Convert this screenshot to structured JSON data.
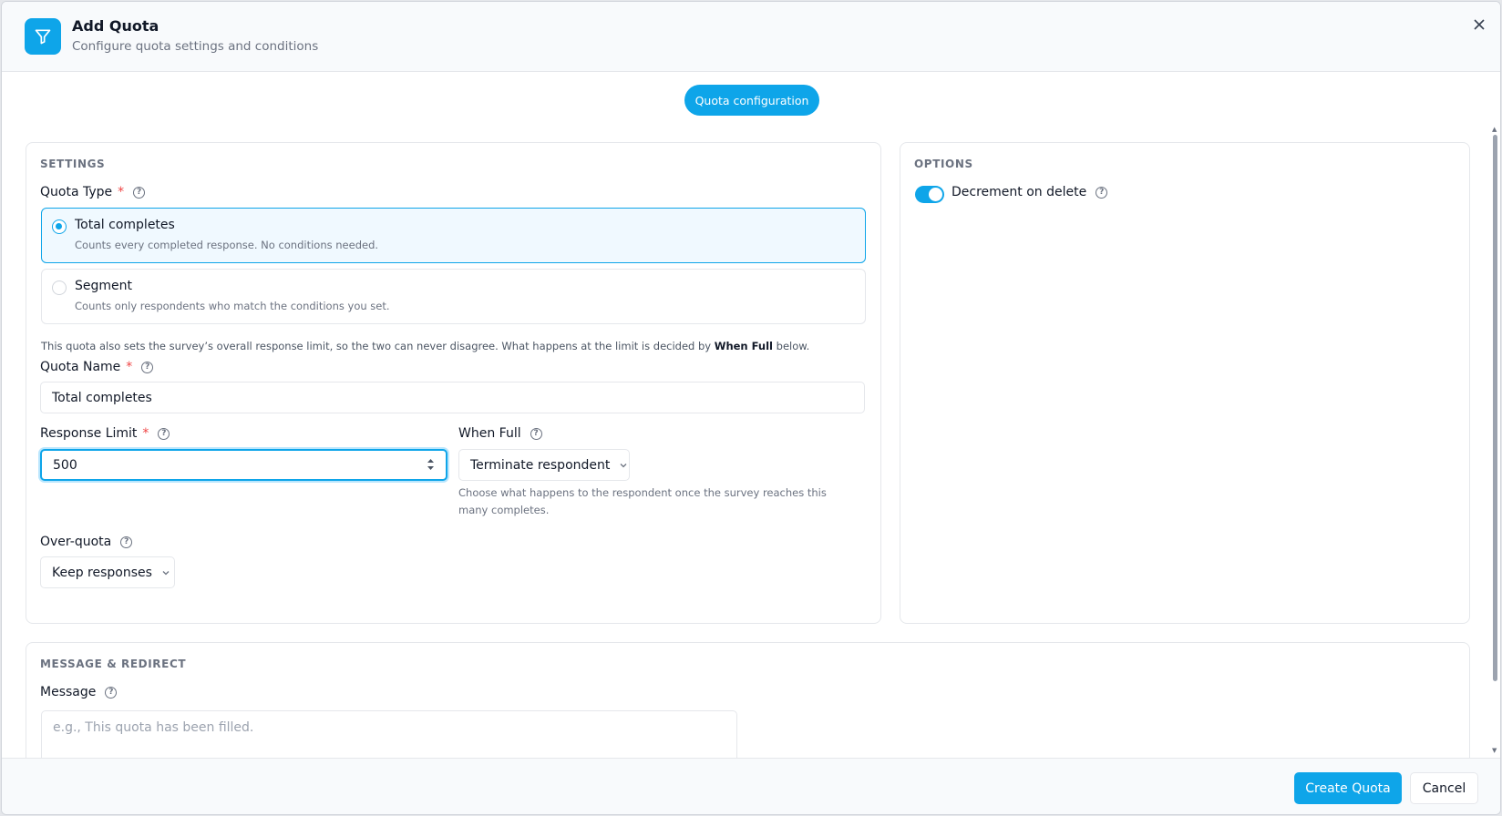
{
  "header": {
    "title": "Add Quota",
    "subtitle": "Configure quota settings and conditions",
    "icon": "filter-icon",
    "close_icon": "close-icon"
  },
  "tabs": {
    "active": "Quota configuration"
  },
  "settings": {
    "section_label": "SETTINGS",
    "quota_type": {
      "label": "Quota Type",
      "required": "*",
      "options": [
        {
          "title": "Total completes",
          "desc": "Counts every completed response. No conditions needed.",
          "selected": true
        },
        {
          "title": "Segment",
          "desc": "Counts only respondents who match the conditions you set.",
          "selected": false
        }
      ]
    },
    "note_prefix": "This quota also sets the survey’s overall response limit, so the two can never disagree. What happens at the limit is decided by ",
    "note_bold": "When Full",
    "note_suffix": " below.",
    "quota_name": {
      "label": "Quota Name",
      "required": "*",
      "value": "Total completes"
    },
    "response_limit": {
      "label": "Response Limit",
      "required": "*",
      "value": "500"
    },
    "when_full": {
      "label": "When Full",
      "value": "Terminate respondent",
      "hint": "Choose what happens to the respondent once the survey reaches this many completes."
    },
    "over_quota": {
      "label": "Over-quota",
      "value": "Keep responses"
    }
  },
  "options": {
    "section_label": "OPTIONS",
    "decrement_on_delete": {
      "label": "Decrement on delete",
      "on": true
    }
  },
  "message_redirect": {
    "section_label": "MESSAGE & REDIRECT",
    "message": {
      "label": "Message",
      "placeholder": "e.g., This quota has been filled."
    }
  },
  "footer": {
    "create_label": "Create Quota",
    "cancel_label": "Cancel"
  },
  "colors": {
    "accent": "#0ea5e9",
    "required": "#ef4444"
  }
}
